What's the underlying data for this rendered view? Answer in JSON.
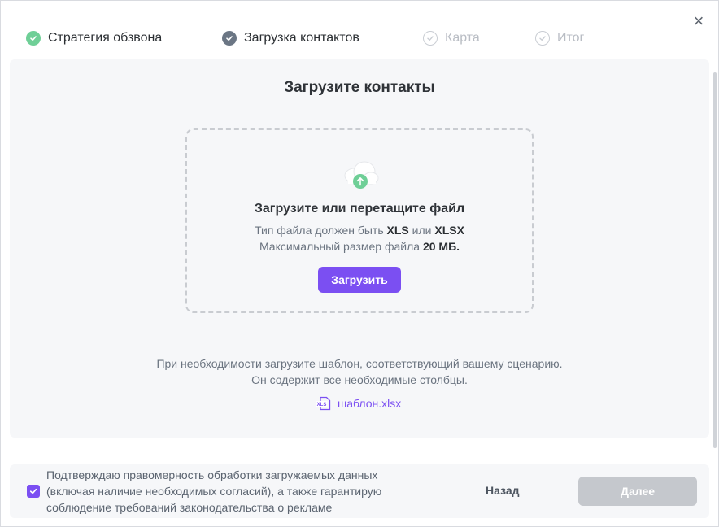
{
  "steps": [
    {
      "label": "Стратегия обзвона",
      "state": "done"
    },
    {
      "label": "Загрузка контактов",
      "state": "active"
    },
    {
      "label": "Карта",
      "state": "pending"
    },
    {
      "label": "Итог",
      "state": "pending"
    }
  ],
  "close_glyph": "×",
  "main": {
    "title": "Загрузите контакты",
    "dropzone": {
      "title": "Загрузите или перетащите файл",
      "type_prefix": "Тип файла должен быть ",
      "type_a": "XLS",
      "type_or": " или ",
      "type_b": "XLSX",
      "size_prefix": "Максимальный размер файла ",
      "size_value": "20 МБ.",
      "upload_label": "Загрузить"
    },
    "hint_line1": "При необходимости загрузите шаблон, соответствующий вашему сценарию.",
    "hint_line2": "Он содержит все необходимые столбцы.",
    "template_file": "шаблон.xlsx",
    "template_icon_text": "XLS"
  },
  "footer": {
    "consent_checked": true,
    "consent_text": "Подтверждаю правомерность обработки загружаемых данных (включая наличие необходимых согласий), а также гарантирую соблюдение требований законодательства о рекламе",
    "back_label": "Назад",
    "next_label": "Далее"
  },
  "colors": {
    "accent": "#7b4ff2",
    "step_done": "#6fcf97",
    "step_active": "#6b7684",
    "disabled": "#c5c8cd"
  }
}
